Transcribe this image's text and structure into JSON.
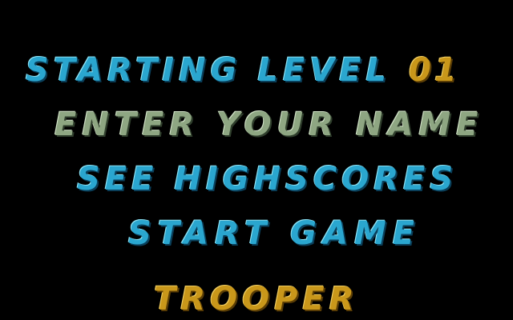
{
  "menu": {
    "starting_level_label": "STARTING LEVEL",
    "starting_level_value": "01",
    "enter_name": "ENTER YOUR NAME",
    "see_highscores": "SEE HIGHSCORES",
    "start_game": "START GAME",
    "player_name": "TROOPER"
  },
  "colors": {
    "background": "#000000",
    "menu_cyan": "#2aa6cf",
    "selected_sage": "#8ea682",
    "value_gold": "#c9971a"
  }
}
